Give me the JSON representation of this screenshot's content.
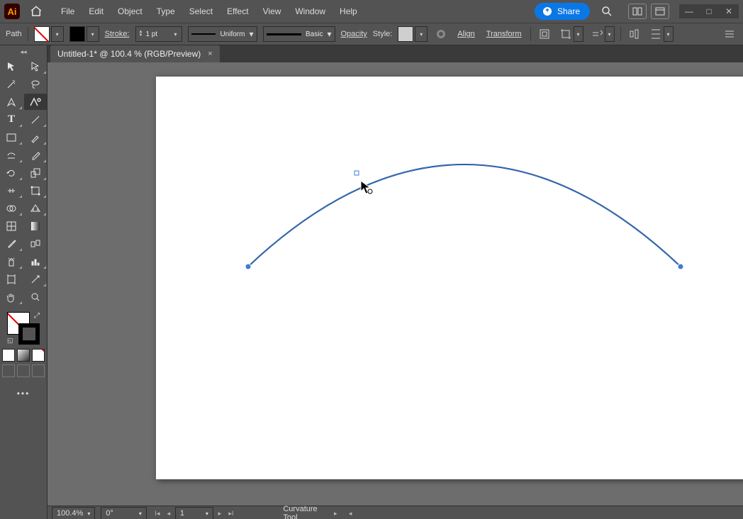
{
  "app_badge": "Ai",
  "menus": [
    "File",
    "Edit",
    "Object",
    "Type",
    "Select",
    "Effect",
    "View",
    "Window",
    "Help"
  ],
  "share_label": "Share",
  "controlbar": {
    "sel_label": "Path",
    "stroke_label": "Stroke:",
    "stroke_weight": "1 pt",
    "brush_uniform": "Uniform",
    "brush_basic": "Basic",
    "opacity_label": "Opacity",
    "style_label": "Style:",
    "align_label": "Align",
    "transform_label": "Transform"
  },
  "tab": {
    "title": "Untitled-1* @ 100.4 % (RGB/Preview)",
    "close": "×"
  },
  "status": {
    "zoom": "100.4%",
    "rotate": "0°",
    "artboard": "1",
    "tool": "Curvature Tool"
  }
}
